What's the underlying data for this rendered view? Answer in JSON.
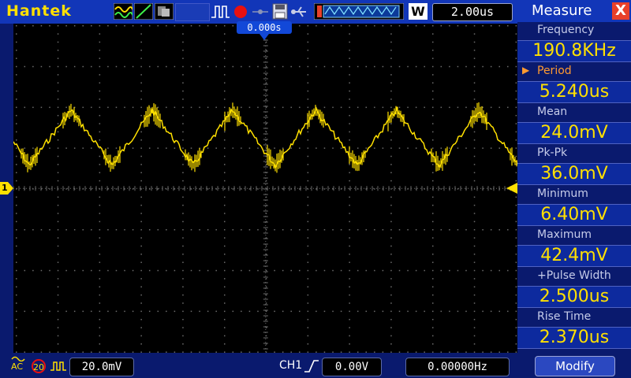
{
  "header": {
    "brand": "Hantek",
    "timebase": "2.00us",
    "trigger_position": "0.000s",
    "window_mode_letter": "W"
  },
  "channel": {
    "marker": "1",
    "coupling": "AC",
    "bandwidth_limit": "20",
    "volts_per_div": "20.0mV",
    "trigger_source": "CH1",
    "trigger_level": "0.00V",
    "frequency_counter": "0.00000Hz"
  },
  "measure": {
    "title": "Measure",
    "close": "X",
    "items": [
      {
        "label": "Frequency",
        "value": "190.8KHz"
      },
      {
        "label": "Period",
        "value": "5.240us"
      },
      {
        "label": "Mean",
        "value": "24.0mV"
      },
      {
        "label": "Pk-Pk",
        "value": "36.0mV"
      },
      {
        "label": "Minimum",
        "value": "6.40mV"
      },
      {
        "label": "Maximum",
        "value": "42.4mV"
      },
      {
        "label": "+Pulse Width",
        "value": "2.500us"
      },
      {
        "label": "Rise Time",
        "value": "2.370us"
      }
    ],
    "selected_index": 1,
    "modify_label": "Modify"
  },
  "colors": {
    "trace": "#ffe000",
    "panel_bg": "#0a1a6e",
    "bar_bg": "#1236b8",
    "highlight": "#ff9a30"
  }
}
